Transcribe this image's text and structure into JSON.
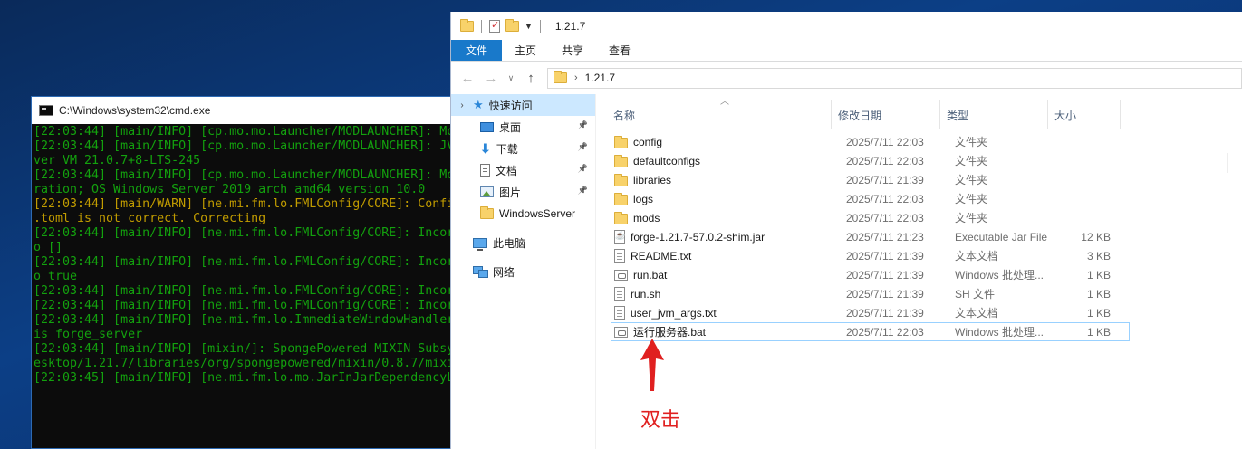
{
  "cmd": {
    "title": "C:\\Windows\\system32\\cmd.exe",
    "lines": [
      {
        "text": "[22:03:44] [main/INFO] [cp.mo.mo.Launcher/MODLAUNCHER]: Mo",
        "level": "info"
      },
      {
        "text": "[22:03:44] [main/INFO] [cp.mo.mo.Launcher/MODLAUNCHER]: JV",
        "level": "info"
      },
      {
        "text": "ver VM 21.0.7+8-LTS-245",
        "level": "info"
      },
      {
        "text": "[22:03:44] [main/INFO] [cp.mo.mo.Launcher/MODLAUNCHER]: Mo",
        "level": "info"
      },
      {
        "text": "ration; OS Windows Server 2019 arch amd64 version 10.0",
        "level": "info"
      },
      {
        "text": "[22:03:44] [main/WARN] [ne.mi.fm.lo.FMLConfig/CORE]: Confi",
        "level": "warn"
      },
      {
        "text": ".toml is not correct. Correcting",
        "level": "warn"
      },
      {
        "text": "[22:03:44] [main/INFO] [ne.mi.fm.lo.FMLConfig/CORE]: Incor",
        "level": "info"
      },
      {
        "text": "o []",
        "level": "info"
      },
      {
        "text": "[22:03:44] [main/INFO] [ne.mi.fm.lo.FMLConfig/CORE]: Incor",
        "level": "info"
      },
      {
        "text": "o true",
        "level": "info"
      },
      {
        "text": "[22:03:44] [main/INFO] [ne.mi.fm.lo.FMLConfig/CORE]: Incor",
        "level": "info"
      },
      {
        "text": "[22:03:44] [main/INFO] [ne.mi.fm.lo.FMLConfig/CORE]: Incor",
        "level": "info"
      },
      {
        "text": "[22:03:44] [main/INFO] [ne.mi.fm.lo.ImmediateWindowHandler",
        "level": "info"
      },
      {
        "text": "is forge_server",
        "level": "info"
      },
      {
        "text": "[22:03:44] [main/INFO] [mixin/]: SpongePowered MIXIN Subsy",
        "level": "info"
      },
      {
        "text": "esktop/1.21.7/libraries/org/spongepowered/mixin/0.8.7/mixi",
        "level": "info"
      },
      {
        "text": "[22:03:45] [main/INFO] [ne.mi.fm.lo.mo.JarInJarDependencyL",
        "level": "info"
      }
    ]
  },
  "explorer": {
    "title": "1.21.7",
    "ribbon_tabs": [
      "文件",
      "主页",
      "共享",
      "查看"
    ],
    "address": "1.21.7",
    "nav": [
      {
        "label": "快速访问",
        "icon": "star-icon",
        "selected": true,
        "caret": true,
        "pinned": false
      },
      {
        "label": "桌面",
        "icon": "desktop-icon",
        "pinned": true
      },
      {
        "label": "下载",
        "icon": "download-icon",
        "pinned": true
      },
      {
        "label": "文档",
        "icon": "document-icon",
        "pinned": true
      },
      {
        "label": "图片",
        "icon": "pictures-icon",
        "pinned": true
      },
      {
        "label": "WindowsServer",
        "icon": "folder-icon",
        "pinned": false
      },
      {
        "label": "此电脑",
        "icon": "computer-icon",
        "pinned": false,
        "gap": true
      },
      {
        "label": "网络",
        "icon": "network-icon",
        "pinned": false,
        "gap": true
      }
    ],
    "columns": {
      "name": "名称",
      "date": "修改日期",
      "type": "类型",
      "size": "大小"
    },
    "files": [
      {
        "name": "config",
        "date": "2025/7/11 22:03",
        "type": "文件夹",
        "size": "",
        "icon": "folder"
      },
      {
        "name": "defaultconfigs",
        "date": "2025/7/11 22:03",
        "type": "文件夹",
        "size": "",
        "icon": "folder"
      },
      {
        "name": "libraries",
        "date": "2025/7/11 21:39",
        "type": "文件夹",
        "size": "",
        "icon": "folder"
      },
      {
        "name": "logs",
        "date": "2025/7/11 22:03",
        "type": "文件夹",
        "size": "",
        "icon": "folder"
      },
      {
        "name": "mods",
        "date": "2025/7/11 22:03",
        "type": "文件夹",
        "size": "",
        "icon": "folder"
      },
      {
        "name": "forge-1.21.7-57.0.2-shim.jar",
        "date": "2025/7/11 21:23",
        "type": "Executable Jar File",
        "size": "12 KB",
        "icon": "jar"
      },
      {
        "name": "README.txt",
        "date": "2025/7/11 21:39",
        "type": "文本文档",
        "size": "3 KB",
        "icon": "file"
      },
      {
        "name": "run.bat",
        "date": "2025/7/11 21:39",
        "type": "Windows 批处理...",
        "size": "1 KB",
        "icon": "bat"
      },
      {
        "name": "run.sh",
        "date": "2025/7/11 21:39",
        "type": "SH 文件",
        "size": "1 KB",
        "icon": "file"
      },
      {
        "name": "user_jvm_args.txt",
        "date": "2025/7/11 21:39",
        "type": "文本文档",
        "size": "1 KB",
        "icon": "file"
      },
      {
        "name": "运行服务器.bat",
        "date": "2025/7/11 22:03",
        "type": "Windows 批处理...",
        "size": "1 KB",
        "icon": "bat",
        "highlight": true
      }
    ]
  },
  "annotation": {
    "text": "双击",
    "color": "#e02020"
  },
  "colors": {
    "accent": "#1979ca",
    "console_text": "#13a10e",
    "console_warn": "#c19c00",
    "selection": "#cce8ff"
  }
}
